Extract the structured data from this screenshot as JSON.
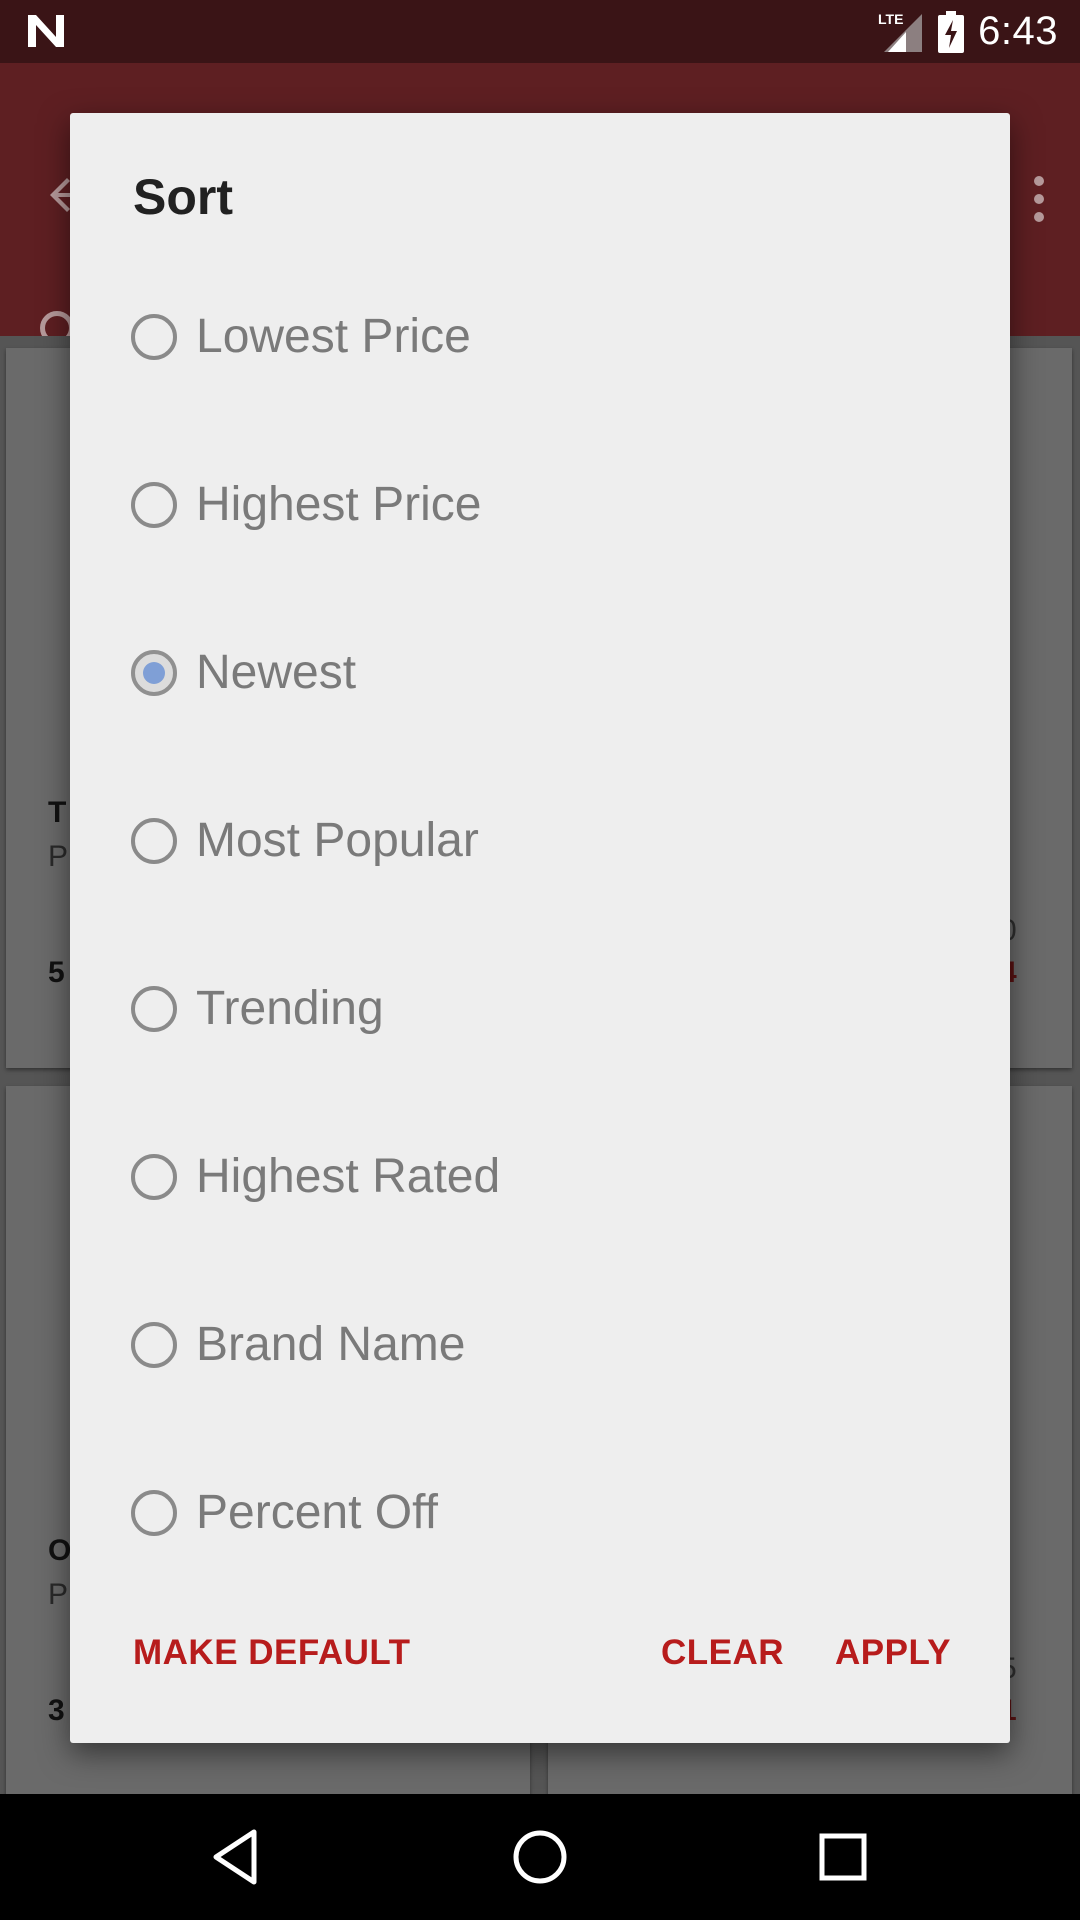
{
  "status_bar": {
    "network": "LTE",
    "time": "6:43"
  },
  "background": {
    "card1": {
      "title": "T",
      "subtitle": "P",
      "price": "5"
    },
    "card2": {
      "old_price": "0",
      "price": "4"
    },
    "card3": {
      "title": "O",
      "subtitle": "P",
      "price": "3"
    },
    "card4": {
      "old_price": "5",
      "price": "1"
    }
  },
  "dialog": {
    "title": "Sort",
    "options": [
      {
        "label": "Lowest Price",
        "checked": false
      },
      {
        "label": "Highest Price",
        "checked": false
      },
      {
        "label": "Newest",
        "checked": true
      },
      {
        "label": "Most Popular",
        "checked": false
      },
      {
        "label": "Trending",
        "checked": false
      },
      {
        "label": "Highest Rated",
        "checked": false
      },
      {
        "label": "Brand Name",
        "checked": false
      },
      {
        "label": "Percent Off",
        "checked": false
      }
    ],
    "actions": {
      "make_default": "MAKE DEFAULT",
      "clear": "CLEAR",
      "apply": "APPLY"
    }
  },
  "colors": {
    "accent": "#b71c1c",
    "radio_checked": "#7f9fd6",
    "app_bar": "#5e1f22"
  },
  "icons": {
    "status_logo": "n-logo-icon",
    "signal": "signal-icon",
    "battery": "battery-charging-icon",
    "back": "back-arrow-icon",
    "overflow": "overflow-menu-icon",
    "nav_back": "nav-back-icon",
    "nav_home": "nav-home-icon",
    "nav_recents": "nav-recents-icon"
  }
}
